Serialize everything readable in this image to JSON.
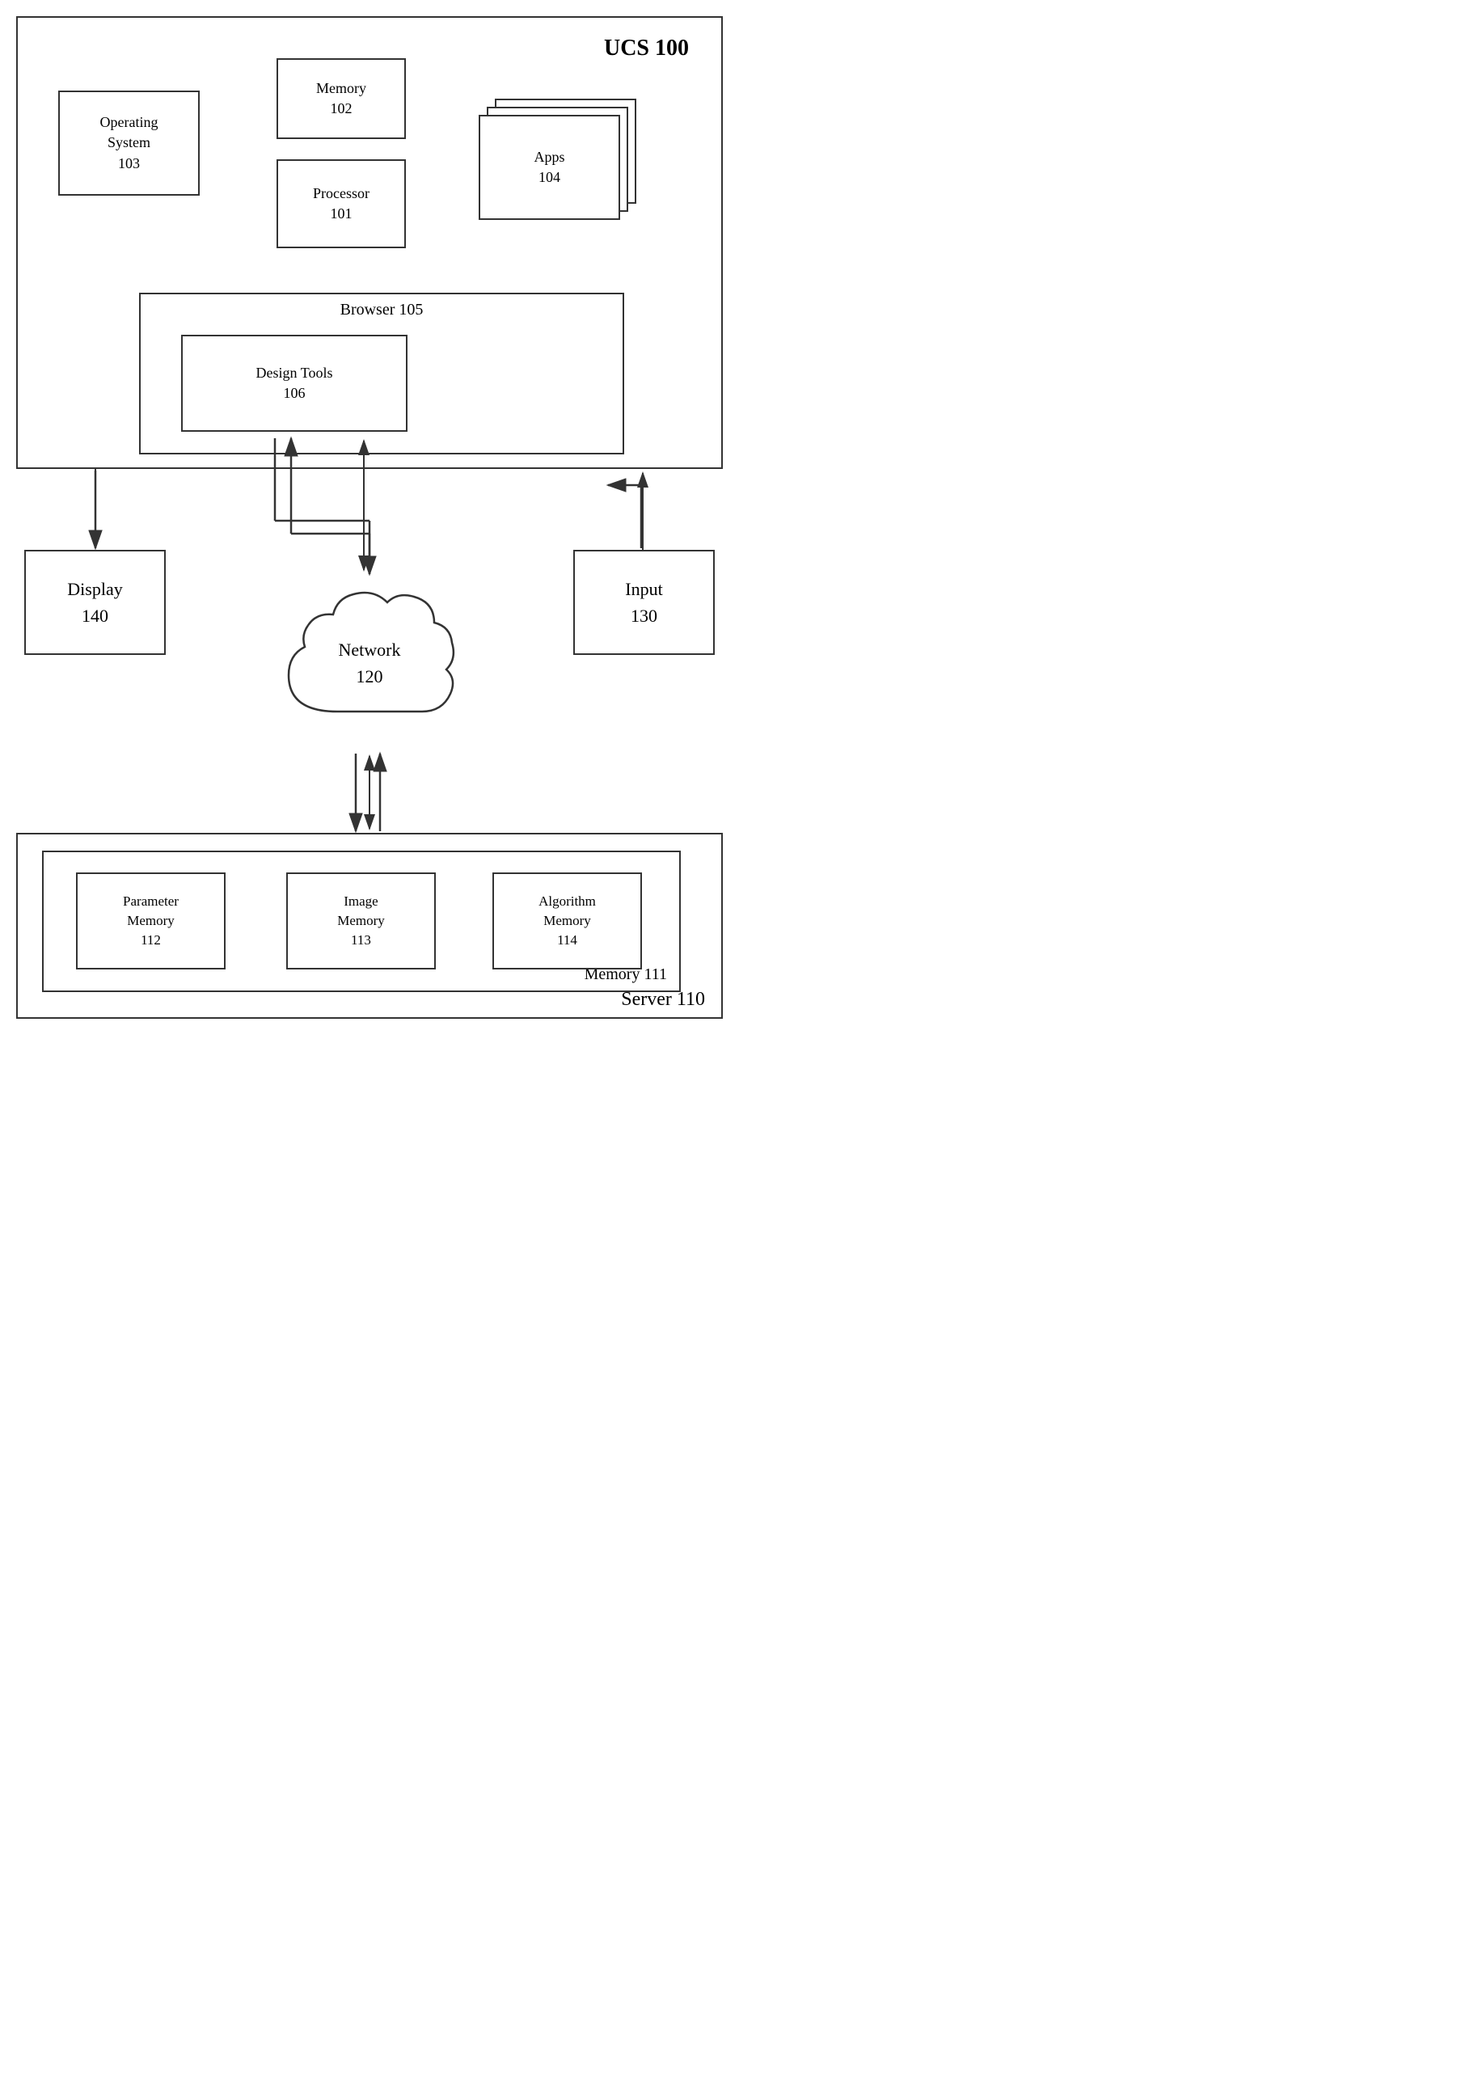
{
  "diagram": {
    "title": "UCS 100",
    "ucs_label": "UCS 100",
    "memory": {
      "label": "Memory",
      "number": "102"
    },
    "processor": {
      "label": "Processor",
      "number": "101"
    },
    "os": {
      "label": "Operating\nSystem",
      "number": "103"
    },
    "apps": {
      "label": "Apps",
      "number": "104"
    },
    "browser": {
      "label": "Browser 105"
    },
    "design_tools": {
      "label": "Design Tools\n106"
    },
    "display": {
      "label": "Display\n140"
    },
    "input": {
      "label": "Input\n130"
    },
    "network": {
      "label": "Network\n120"
    },
    "server": {
      "label": "Server 110"
    },
    "memory111": {
      "label": "Memory 111"
    },
    "param_memory": {
      "label": "Parameter\nMemory\n112"
    },
    "image_memory": {
      "label": "Image\nMemory\n113"
    },
    "algo_memory": {
      "label": "Algorithm\nMemory\n114"
    }
  }
}
